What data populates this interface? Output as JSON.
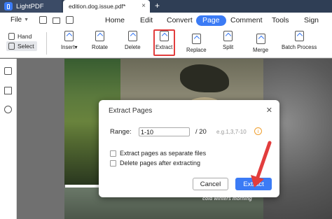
{
  "titlebar": {
    "app_name": "LightPDF",
    "doc_tab": "edition.dog.issue.pdf*",
    "close_glyph": "×",
    "add_tab_glyph": "+"
  },
  "menubar": {
    "file_label": "File",
    "items": [
      {
        "label": "Home"
      },
      {
        "label": "Edit"
      },
      {
        "label": "Convert"
      },
      {
        "label": "Page",
        "active": true
      },
      {
        "label": "Comment"
      },
      {
        "label": "Tools"
      },
      {
        "label": "Sign"
      }
    ]
  },
  "toolbar": {
    "hand_label": "Hand",
    "select_label": "Select",
    "tools": [
      {
        "label": "Insert",
        "icon": "insert-page-icon",
        "has_dropdown": true
      },
      {
        "label": "Rotate",
        "icon": "rotate-page-icon"
      },
      {
        "label": "Delete",
        "icon": "delete-page-icon"
      },
      {
        "label": "Extract",
        "icon": "extract-page-icon",
        "highlighted": true
      },
      {
        "label": "Replace",
        "icon": "replace-page-icon"
      },
      {
        "label": "Split",
        "icon": "split-page-icon"
      },
      {
        "label": "Merge",
        "icon": "merge-page-icon"
      },
      {
        "label": "Batch Process",
        "icon": "batch-process-icon"
      }
    ],
    "highlight_color": "#e23d3d"
  },
  "content": {
    "caption": "cold winters morning"
  },
  "dialog": {
    "title": "Extract Pages",
    "close_glyph": "✕",
    "range_label": "Range:",
    "range_value": "1-10",
    "range_total": "/ 20",
    "range_hint": "e.g.1,3,7-10",
    "info_glyph": "i",
    "option_separate": "Extract pages as separate files",
    "option_delete": "Delete pages after extracting",
    "cancel_label": "Cancel",
    "extract_label": "Extract"
  },
  "colors": {
    "accent": "#3b7bf5",
    "titlebar": "#2f3e55",
    "annotation_red": "#e23d3d"
  }
}
